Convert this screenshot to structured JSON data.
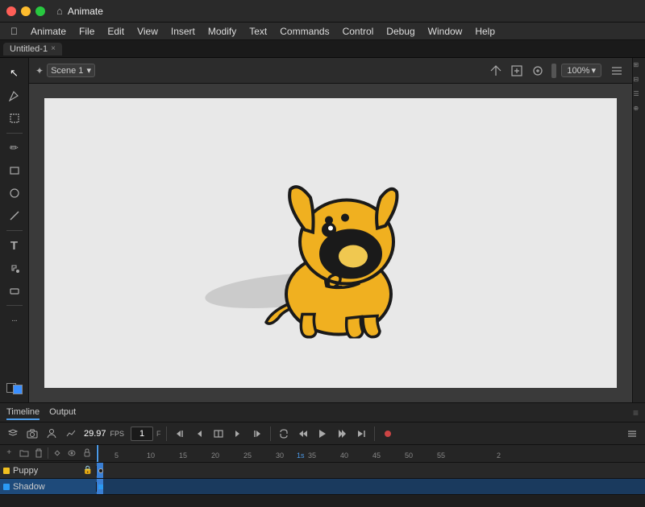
{
  "title_bar": {
    "app_name": "Animate",
    "home_icon": "⌂"
  },
  "menu": {
    "items": [
      "Apple",
      "Animate",
      "File",
      "Edit",
      "View",
      "Insert",
      "Modify",
      "Text",
      "Commands",
      "Control",
      "Debug",
      "Window",
      "Help"
    ]
  },
  "tab": {
    "label": "Untitled-1",
    "close": "×"
  },
  "stage_toolbar": {
    "scene_icon": "✦",
    "scene_label": "Scene 1",
    "chevron": "▾",
    "nav_icons": [
      "⊕",
      "◈",
      "↕"
    ],
    "zoom": "100%",
    "zoom_chevron": "▾",
    "right_icons": [
      "⊞"
    ]
  },
  "tools": [
    {
      "name": "selection",
      "icon": "↖"
    },
    {
      "name": "subselection",
      "icon": "↗"
    },
    {
      "name": "transform",
      "icon": "⊹"
    },
    {
      "name": "pencil",
      "icon": "✏"
    },
    {
      "name": "rectangle",
      "icon": "□"
    },
    {
      "name": "oval",
      "icon": "○"
    },
    {
      "name": "line",
      "icon": "/"
    },
    {
      "name": "text",
      "icon": "T"
    },
    {
      "name": "paint-bucket",
      "icon": "◪"
    },
    {
      "name": "eraser",
      "icon": "◻"
    },
    {
      "name": "more",
      "icon": "···"
    }
  ],
  "timeline": {
    "tabs": [
      {
        "label": "Timeline",
        "active": true
      },
      {
        "label": "Output",
        "active": false
      }
    ],
    "fps": "29.97",
    "fps_label": "FPS",
    "frame": "1",
    "frame_label": "F",
    "controls": [
      "layers-icon",
      "camera-icon",
      "person-icon",
      "chart-icon"
    ],
    "playback": [
      "prev-keyframe",
      "prev-frame",
      "play",
      "next-frame",
      "next-keyframe",
      "loop",
      "rewind",
      "play-all",
      "skip-end",
      "record"
    ],
    "ruler_marks": [
      "1s",
      "2"
    ],
    "layer_controls": [
      "add",
      "folder",
      "delete",
      "keyframe",
      "visibility",
      "lock"
    ],
    "layers": [
      {
        "name": "Puppy",
        "color": "#f0c020",
        "has_keyframe": true,
        "selected": false
      },
      {
        "name": "Shadow",
        "color": "#2b9af3",
        "has_keyframe": true,
        "selected": true
      }
    ]
  },
  "dog": {
    "body_color": "#f0b020",
    "outline_color": "#1a1a1a"
  }
}
